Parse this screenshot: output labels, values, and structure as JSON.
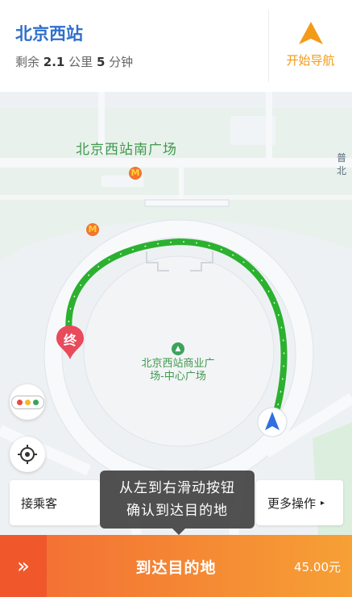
{
  "header": {
    "destination": "北京西站",
    "trip_prefix": "剩余",
    "distance_value": "2.1",
    "distance_unit": "公里",
    "time_value": "5",
    "time_unit": "分钟",
    "start_nav_label": "开始导航"
  },
  "map": {
    "south_plaza_label": "北京西站南广场",
    "plaza_label_line1": "北京西站商业广",
    "plaza_label_line2": "场-中心广场",
    "edge_label_line1": "普",
    "edge_label_line2": "北",
    "mcd_icon": "M",
    "end_marker_label": "终",
    "plaza_icon": "store-icon",
    "car_icon": "navigation-arrow-icon",
    "route_color": "#2bb12f",
    "traffic_colors": [
      "#e84a3c",
      "#f5b82e",
      "#3aa45a"
    ]
  },
  "actions": {
    "pickup_label": "接乘客",
    "more_label": "更多操作",
    "more_caret": "▸"
  },
  "tooltip": {
    "line1": "从左到右滑动按钮",
    "line2": "确认到达目的地"
  },
  "slider": {
    "handle_icon": "»",
    "label": "到达目的地",
    "fare": "45.00元"
  },
  "colors": {
    "accent_orange": "#f39a19",
    "title_blue": "#2f6fcc",
    "slider_start": "#f36a34",
    "slider_end": "#f6a035"
  }
}
